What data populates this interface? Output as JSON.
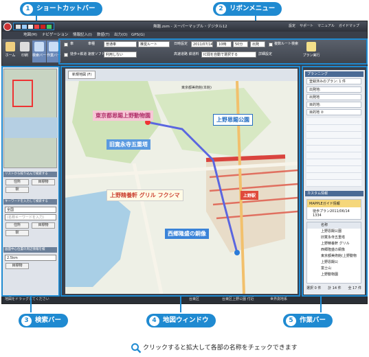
{
  "callouts": {
    "shortcut_bar": {
      "num": "1",
      "label": "ショートカットバー"
    },
    "ribbon_menu": {
      "num": "2",
      "label": "リボンメニュー"
    },
    "search_bar": {
      "num": "3",
      "label": "検索バー"
    },
    "map_window": {
      "num": "4",
      "label": "地図ウィンドウ"
    },
    "work_bar": {
      "num": "5",
      "label": "作業バー"
    }
  },
  "app": {
    "title": "無題.zsm - スーパーマップル・デジタル12",
    "header_links": [
      "設定",
      "サポート",
      "マニュアル",
      "ガイドマップ"
    ],
    "tabs": [
      "地図(M)",
      "ナビゲーション",
      "情報記入(I)",
      "数値(T)",
      "出力(O)",
      "GPS(G)"
    ],
    "active_tab": "ナビゲーション"
  },
  "ribbon": {
    "buttons": [
      "ホーム",
      "印刷",
      "検索バー",
      "作業バー"
    ],
    "car_label": "車",
    "transfer_label": "徒歩+鉄道 速度ソフト",
    "vehicle_label": "車種",
    "vehicle_value": "普通車",
    "route_value": "推奨ルート",
    "toll_value": "利用しない",
    "date_label": "日時設定",
    "date_value": "2011/07/14",
    "hour_value": "10時",
    "min_value": "50分",
    "depart_value": "出発",
    "other_route": "複数ルート検索",
    "highway_label": "高速道路 鉄道料",
    "highway_value": "IC間を自動で選択する",
    "detail_label": "詳細設定",
    "execute_label": "プラン実行"
  },
  "left_panel": {
    "section1": "リストから絞り込んで検索する",
    "btn_residence": "住所",
    "btn_landmark": "目標物",
    "btn_station": "駅",
    "section2": "キーワードを入力して検索する",
    "select_area": "全国",
    "input_placeholder": "(名称キーワードを入力)",
    "btn_residence2": "住所",
    "btn_landmark2": "目標物",
    "btn_station2": "駅",
    "section3": "画面中心位置の周辺情報を検",
    "select_radius": "2.5km",
    "btn_landmark3": "目標物"
  },
  "map": {
    "tab": "新規地図 (F)",
    "labels": {
      "zoo": "東京都恩賜上野動物園",
      "pagoda": "旧寛永寺五重塔",
      "park": "上野恩賜公園",
      "restaurant": "上野精養軒 グリル フクシマ",
      "statue": "西郷隆盛の銅像",
      "station": "上野駅",
      "museum": "東京都美術館(本館)"
    }
  },
  "right_panel": {
    "section_planning": "プランニング",
    "registered_plan": "登録済みのプラン: 1 件",
    "open_label": "開く",
    "rows": [
      "出発地:",
      "出発地",
      "目的地:",
      "目的地 ②"
    ],
    "section_custom": "カスタム情報",
    "tree_root": "MAPPLEガイド情報",
    "tree_child": "徒歩プラン2011/06/14 1334",
    "list_header": "名称",
    "list_items": [
      "上野恩賜公園",
      "旧寛永寺五重塔",
      "上野精養軒 グリル",
      "西郷隆盛の銅像",
      "東京都美術館(上野動物",
      "上野恩賜公",
      "富士山",
      "上野動物園"
    ],
    "footer": [
      "選択 0 件",
      "計 14 件",
      "全 17 件"
    ]
  },
  "statusbar": {
    "left": "地図をドラッグしてください",
    "middle": "台東区",
    "center": "台東区上野公園 付近",
    "right": "世界測地系"
  },
  "footer_note": "クリックすると拡大して各部の名称をチェックできます"
}
